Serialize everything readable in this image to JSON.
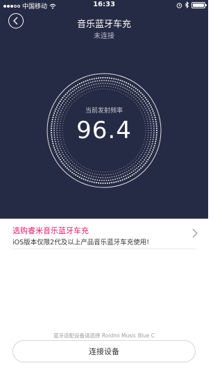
{
  "status_bar": {
    "carrier": "中国移动",
    "time": "16:33",
    "battery_level": 1.0,
    "icons": [
      "signal-dots-icon",
      "wifi-icon",
      "alarm-icon",
      "bluetooth-icon",
      "battery-icon"
    ]
  },
  "header": {
    "back_icon": "chevron-left-icon",
    "title": "音乐蓝牙车充",
    "subtitle": "未连接"
  },
  "dial": {
    "label": "当前发射频率",
    "frequency": "96.4"
  },
  "promo": {
    "title": "选购睿米音乐蓝牙车充",
    "description": "iOS版本仅限2代及以上产品音乐蓝牙车充使用!",
    "chevron_icon": "chevron-right-icon"
  },
  "footer": {
    "hint": "蓝牙适配设备请选择 Roidmi Music Blue C",
    "connect_label": "连接设备"
  },
  "colors": {
    "header_background": "#262b45",
    "promo_title": "#e8196c"
  }
}
